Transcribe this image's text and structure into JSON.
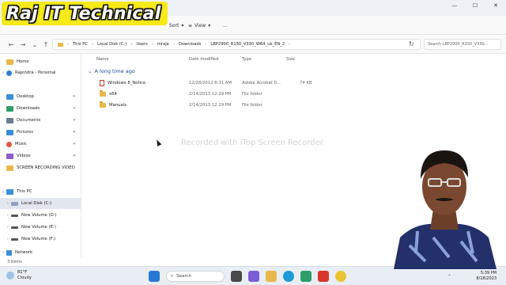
{
  "overlay": {
    "channel_logo": "Raj IT Technical",
    "watermark": "Recorded with iTop Screen Recorder"
  },
  "toolbar": {
    "sort_label": "Sort",
    "view_label": "View",
    "more_label": "..."
  },
  "address": {
    "crumbs": [
      "This PC",
      "Local Disk (C:)",
      "Users",
      "mraje",
      "Downloads",
      "LBP2900_R150_V330_W64_uk_EN_2"
    ],
    "search_placeholder": "Search LBP2900_R150_V330..."
  },
  "sidebar": {
    "home": "Home",
    "account": "Rajendra - Personal",
    "quick": [
      {
        "label": "Desktop",
        "color": "#3a8fd8"
      },
      {
        "label": "Downloads",
        "color": "#2e9e6b"
      },
      {
        "label": "Documents",
        "color": "#6b7c93"
      },
      {
        "label": "Pictures",
        "color": "#3a8fd8"
      },
      {
        "label": "Music",
        "color": "#e2553f"
      },
      {
        "label": "Videos",
        "color": "#8b5cc7"
      },
      {
        "label": "SCREEN RECORDING VIDEO",
        "color": "#e8b94a"
      }
    ],
    "this_pc": "This PC",
    "drives": [
      "Local Disk (C:)",
      "New Volume (D:)",
      "New Volume (E:)",
      "New Volume (F:)"
    ],
    "network": "Network"
  },
  "main": {
    "columns": {
      "name": "Name",
      "date": "Date modified",
      "type": "Type",
      "size": "Size"
    },
    "group_label": "A long time ago",
    "files": [
      {
        "name": "Windows 8_Notice",
        "date": "12/28/2012 8:31 AM",
        "type": "Adobe Acrobat D...",
        "size": "74 KB",
        "kind": "pdf"
      },
      {
        "name": "x64",
        "date": "2/14/2013 12:29 PM",
        "type": "File folder",
        "size": "",
        "kind": "folder"
      },
      {
        "name": "Manuals",
        "date": "2/14/2013 12:29 PM",
        "type": "File folder",
        "size": "",
        "kind": "folder"
      }
    ]
  },
  "status": {
    "items_count": "3 items"
  },
  "taskbar": {
    "weather_temp": "81°F",
    "weather_desc": "Cloudy",
    "search_label": "Search",
    "time": "5:39 PM",
    "date": "8/18/2023"
  }
}
